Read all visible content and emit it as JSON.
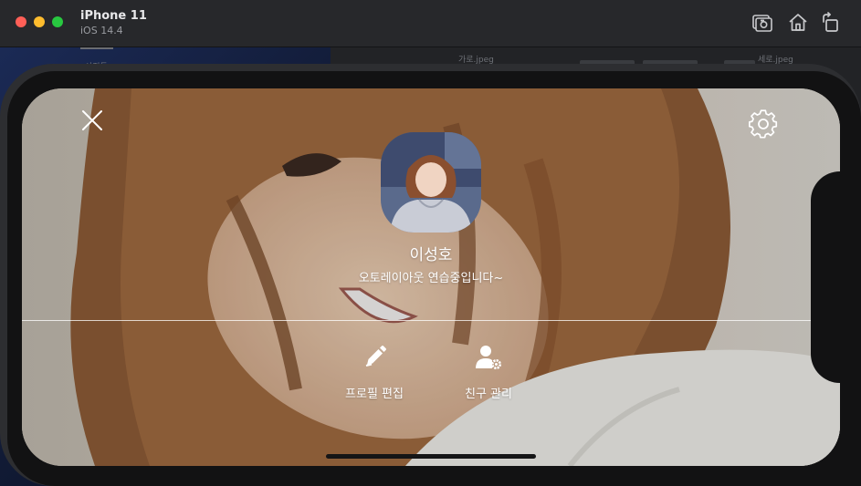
{
  "simulator": {
    "device_name": "iPhone 11",
    "os_version": "iOS 14.4",
    "toolbar_icons": [
      "screenshot-icon",
      "home-icon",
      "rotate-icon"
    ]
  },
  "background": {
    "tab_label": "사진들",
    "file_1": "가로.jpeg",
    "file_2": "세로.jpeg"
  },
  "profile": {
    "name": "이성호",
    "status_message": "오토레이아웃 연습중입니다~",
    "actions": [
      {
        "label": "프로필 편집",
        "icon": "pencil-icon"
      },
      {
        "label": "친구 관리",
        "icon": "person-gear-icon"
      }
    ],
    "close_icon": "close-icon",
    "settings_icon": "gear-icon"
  },
  "colors": {
    "titlebar": "#27282b",
    "text_on_photo": "#ffffff",
    "traffic_red": "#ff5f57",
    "traffic_yellow": "#febc2e",
    "traffic_green": "#28c840"
  }
}
